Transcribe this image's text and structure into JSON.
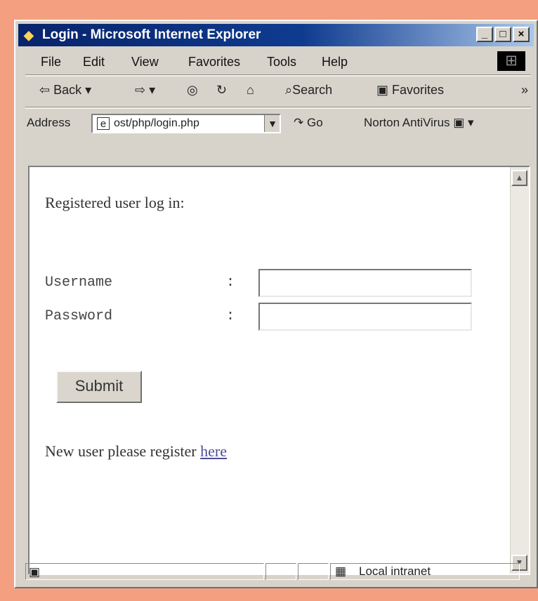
{
  "window": {
    "title": "Login - Microsoft Internet Explorer"
  },
  "menu": {
    "items": [
      "File",
      "Edit",
      "View",
      "Favorites",
      "Tools",
      "Help"
    ]
  },
  "toolbar": {
    "back": "Back",
    "search": "Search",
    "favorites": "Favorites",
    "more": "»"
  },
  "address": {
    "label": "Address",
    "url": "ost/php/login.php",
    "go": "Go",
    "norton": "Norton AntiVirus"
  },
  "page": {
    "heading": "Registered user log in:",
    "username_label": "Username",
    "password_label": "Password",
    "colon": ":",
    "submit": "Submit",
    "register_text": "New user please register",
    "register_link": "here"
  },
  "status": {
    "zone": "Local intranet"
  },
  "icons": {
    "ie_icon": "internet-explorer-icon",
    "page_icon": "page-icon",
    "windows_logo": "windows-logo-icon",
    "stop_icon": "stop-icon",
    "refresh_icon": "refresh-icon",
    "home_icon": "home-icon",
    "search_icon": "search-icon",
    "favorites_icon": "favorites-icon",
    "go_icon": "go-arrow-icon",
    "norton_icon": "norton-icon",
    "intranet_icon": "local-intranet-icon"
  }
}
